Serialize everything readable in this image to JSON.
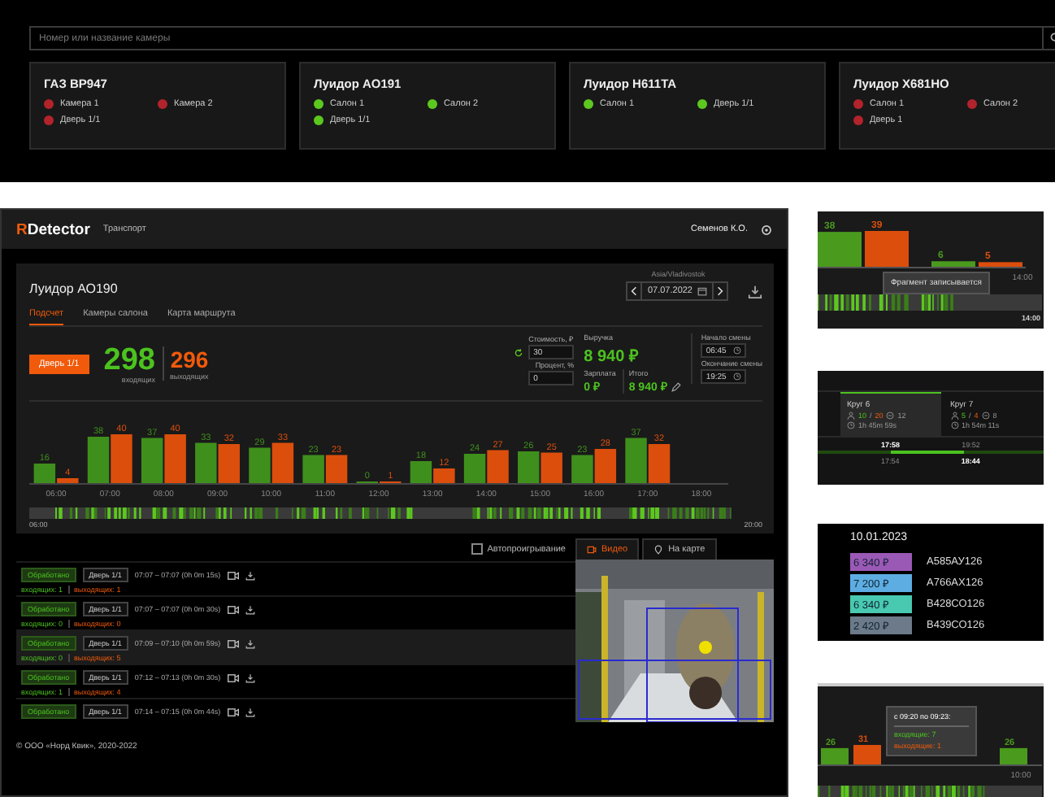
{
  "camera_search": {
    "placeholder": "Номер или название камеры",
    "cards": [
      {
        "title": "ГАЗ ВР947",
        "cameras": [
          {
            "name": "Камера 1",
            "color": "#b3232b"
          },
          {
            "name": "Камера 2",
            "color": "#b3232b"
          },
          {
            "name": "Дверь 1/1",
            "color": "#b3232b"
          }
        ]
      },
      {
        "title": "Луидор АО191",
        "cameras": [
          {
            "name": "Салон 1",
            "color": "#5cc71f"
          },
          {
            "name": "Салон 2",
            "color": "#5cc71f"
          },
          {
            "name": "Дверь 1/1",
            "color": "#5cc71f"
          }
        ]
      },
      {
        "title": "Луидор Н611ТА",
        "cameras": [
          {
            "name": "Салон 1",
            "color": "#5cc71f"
          },
          {
            "name": "Дверь 1/1",
            "color": "#5cc71f"
          }
        ]
      },
      {
        "title": "Луидор Х681НО",
        "cameras": [
          {
            "name": "Салон 1",
            "color": "#b3232b"
          },
          {
            "name": "Салон 2",
            "color": "#b3232b"
          },
          {
            "name": "Дверь 1",
            "color": "#b3232b"
          }
        ]
      }
    ]
  },
  "app": {
    "logo": {
      "accent": "R",
      "rest": "Detector"
    },
    "nav": "Транспорт",
    "user": "Семенов К.О.",
    "vehicle": "Луидор АО190",
    "timezone": "Asia/Vladivostok",
    "date": "07.07.2022",
    "tabs": [
      {
        "label": "Подсчет",
        "selected": true
      },
      {
        "label": "Камеры салона",
        "selected": false
      },
      {
        "label": "Карта маршрута",
        "selected": false
      }
    ],
    "door_button": "Дверь 1/1",
    "incoming": {
      "value": "298",
      "label": "входящих"
    },
    "outgoing": {
      "value": "296",
      "label": "выходящих"
    },
    "cost": {
      "label": "Стоимость, ₽",
      "value": "30"
    },
    "percent": {
      "label": "Процент, %",
      "value": "0"
    },
    "revenue": {
      "label": "Выручка",
      "value": "8 940 ₽"
    },
    "salary": {
      "label": "Зарплата",
      "value": "0 ₽"
    },
    "total": {
      "label": "Итого",
      "value": "8 940 ₽"
    },
    "shift_start": {
      "label": "Начало смены",
      "value": "06:45"
    },
    "shift_end": {
      "label": "Окончание смены",
      "value": "19:25"
    },
    "chart_data": {
      "type": "bar",
      "categories": [
        "06:00",
        "07:00",
        "08:00",
        "09:00",
        "10:00",
        "11:00",
        "12:00",
        "13:00",
        "14:00",
        "15:00",
        "16:00",
        "17:00",
        "18:00"
      ],
      "series": [
        {
          "color": "#3f8f1c",
          "values": [
            16,
            38,
            37,
            33,
            29,
            23,
            0,
            18,
            24,
            26,
            23,
            37,
            null
          ]
        },
        {
          "color": "#dc4e0c",
          "values": [
            4,
            40,
            40,
            32,
            33,
            23,
            1,
            12,
            27,
            25,
            28,
            32,
            null
          ]
        }
      ],
      "data_labels": true
    },
    "strip": {
      "start": "06:00",
      "end": "20:00"
    },
    "autoplay": {
      "label": "Автопроигрывание",
      "checked": false
    },
    "media_tabs": [
      {
        "label": "Видео",
        "selected": true
      },
      {
        "label": "На карте",
        "selected": false
      }
    ],
    "recordings": [
      {
        "status": "Обработано",
        "door": "Дверь 1/1",
        "range": "07:07 – 07:07 (0h 0m 15s)",
        "incoming": "входящих: 1",
        "outgoing": "выходящих: 1",
        "selected": false
      },
      {
        "status": "Обработано",
        "door": "Дверь 1/1",
        "range": "07:07 – 07:07 (0h 0m 30s)",
        "incoming": "входящих: 0",
        "outgoing": "выходящих: 0",
        "selected": false
      },
      {
        "status": "Обработано",
        "door": "Дверь 1/1",
        "range": "07:09 – 07:10 (0h 0m 59s)",
        "incoming": "входящих: 0",
        "outgoing": "выходящих: 5",
        "selected": true
      },
      {
        "status": "Обработано",
        "door": "Дверь 1/1",
        "range": "07:12 – 07:13 (0h 0m 30s)",
        "incoming": "входящих: 1",
        "outgoing": "выходящих: 4",
        "selected": false
      },
      {
        "status": "Обработано",
        "door": "Дверь 1/1",
        "range": "07:14 – 07:15 (0h 0m 44s)",
        "selected": false
      }
    ],
    "footer": "© ООО «Норд Квик», 2020-2022"
  },
  "fragment_panel": {
    "bars": [
      {
        "label": "38",
        "kind": "incoming"
      },
      {
        "label": "39",
        "kind": "outgoing"
      },
      {
        "label": "6",
        "kind": "incoming"
      },
      {
        "label": "5",
        "kind": "outgoing"
      }
    ],
    "tick": "14:00",
    "tooltip": "Фрагмент записывается",
    "strip_end": "14:00"
  },
  "rounds_panel": {
    "rounds": [
      {
        "title": "Круг 6",
        "in": "10",
        "separator": "/",
        "out": "20",
        "stops": "12",
        "duration": "1h 45m 59s",
        "selected": true
      },
      {
        "title": "Круг 7",
        "in": "5",
        "separator": "/",
        "out": "4",
        "stops": "8",
        "duration": "1h 54m 11s",
        "selected": false
      }
    ],
    "times_top": [
      {
        "text": "17:58",
        "emphasis": true
      },
      {
        "text": "19:52",
        "emphasis": false
      }
    ],
    "times_bottom": [
      {
        "text": "17:54",
        "emphasis": false
      },
      {
        "text": "18:44",
        "emphasis": true
      }
    ]
  },
  "prices_panel": {
    "date": "10.01.2023",
    "rows": [
      {
        "amount": "6 340 ₽",
        "plate": "А585АУ126",
        "color": "#9b59b6"
      },
      {
        "amount": "7 200 ₽",
        "plate": "А766АХ126",
        "color": "#5dade2"
      },
      {
        "amount": "6 340 ₽",
        "plate": "В428СО126",
        "color": "#48c9b0"
      },
      {
        "amount": "2 420 ₽",
        "plate": "В439СО126",
        "color": "#6c7a89"
      }
    ]
  },
  "interval_panel": {
    "bars": [
      {
        "label": "26",
        "kind": "incoming"
      },
      {
        "label": "31",
        "kind": "outgoing"
      },
      {
        "label": "26",
        "kind": "incoming"
      }
    ],
    "tick": "10:00",
    "tooltip": {
      "title": "с 09:20 по 09:23:",
      "incoming": "входящие: 7",
      "outgoing": "выходящие: 1"
    }
  }
}
